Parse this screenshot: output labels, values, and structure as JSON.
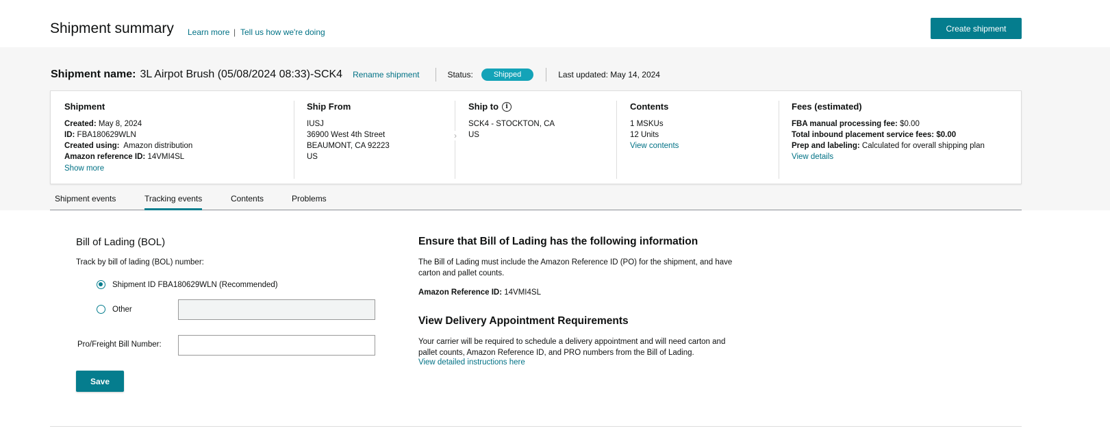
{
  "header": {
    "title": "Shipment summary",
    "learn_more": "Learn more",
    "separator": "|",
    "tell_us": "Tell us how we're doing",
    "create_button": "Create shipment"
  },
  "shipment_bar": {
    "name_label": "Shipment name:",
    "name_value": "3L Airpot Brush (05/08/2024 08:33)-SCK4",
    "rename_link": "Rename shipment",
    "status_label": "Status:",
    "status_value": "Shipped",
    "last_updated": "Last updated: May 14, 2024"
  },
  "card": {
    "shipment": {
      "title": "Shipment",
      "created_label": "Created:",
      "created_value": "May 8, 2024",
      "id_label": "ID:",
      "id_value": "FBA180629WLN",
      "created_using_label": "Created using:",
      "created_using_value": "Amazon distribution",
      "ref_label": "Amazon reference ID:",
      "ref_value": "14VMI4SL",
      "show_more": "Show more"
    },
    "ship_from": {
      "title": "Ship From",
      "line1": "IUSJ",
      "line2": "36900 West 4th Street",
      "line3": "BEAUMONT, CA 92223",
      "line4": "US"
    },
    "ship_to": {
      "title": "Ship to",
      "line1": "SCK4 - STOCKTON, CA",
      "line2": "US"
    },
    "contents": {
      "title": "Contents",
      "mskus": "1 MSKUs",
      "units": "12 Units",
      "view_contents": "View contents"
    },
    "fees": {
      "title": "Fees (estimated)",
      "fba_label": "FBA manual processing fee:",
      "fba_value": "$0.00",
      "inbound_label": "Total inbound placement service fees:",
      "inbound_value": "$0.00",
      "prep_label": "Prep and labeling:",
      "prep_value": "Calculated for overall shipping plan",
      "view_details": "View details"
    }
  },
  "tabs": [
    {
      "label": "Shipment events",
      "active": false
    },
    {
      "label": "Tracking events",
      "active": true
    },
    {
      "label": "Contents",
      "active": false
    },
    {
      "label": "Problems",
      "active": false
    }
  ],
  "bol_form": {
    "title": "Bill of Lading (BOL)",
    "track_label": "Track by bill of lading (BOL) number:",
    "option_shipment_id": "Shipment ID FBA180629WLN (Recommended)",
    "option_other": "Other",
    "other_value": "",
    "pro_label": "Pro/Freight Bill Number:",
    "pro_value": "",
    "save_button": "Save"
  },
  "info_panel": {
    "heading1": "Ensure that Bill of Lading has the following information",
    "para1": "The Bill of Lading must include the Amazon Reference ID (PO) for the shipment, and have carton and pallet counts.",
    "ref_label": "Amazon Reference ID:",
    "ref_value": "14VMI4SL",
    "heading2": "View Delivery Appointment Requirements",
    "para2": "Your carrier will be required to schedule a delivery appointment and will need carton and pallet counts, Amazon Reference ID, and PRO numbers from the Bill of Lading.",
    "instructions_link": "View detailed instructions here"
  },
  "colors": {
    "accent": "#057d8e",
    "link": "#007185",
    "status_badge": "#14a3b8",
    "band": "#f6f6f6"
  }
}
